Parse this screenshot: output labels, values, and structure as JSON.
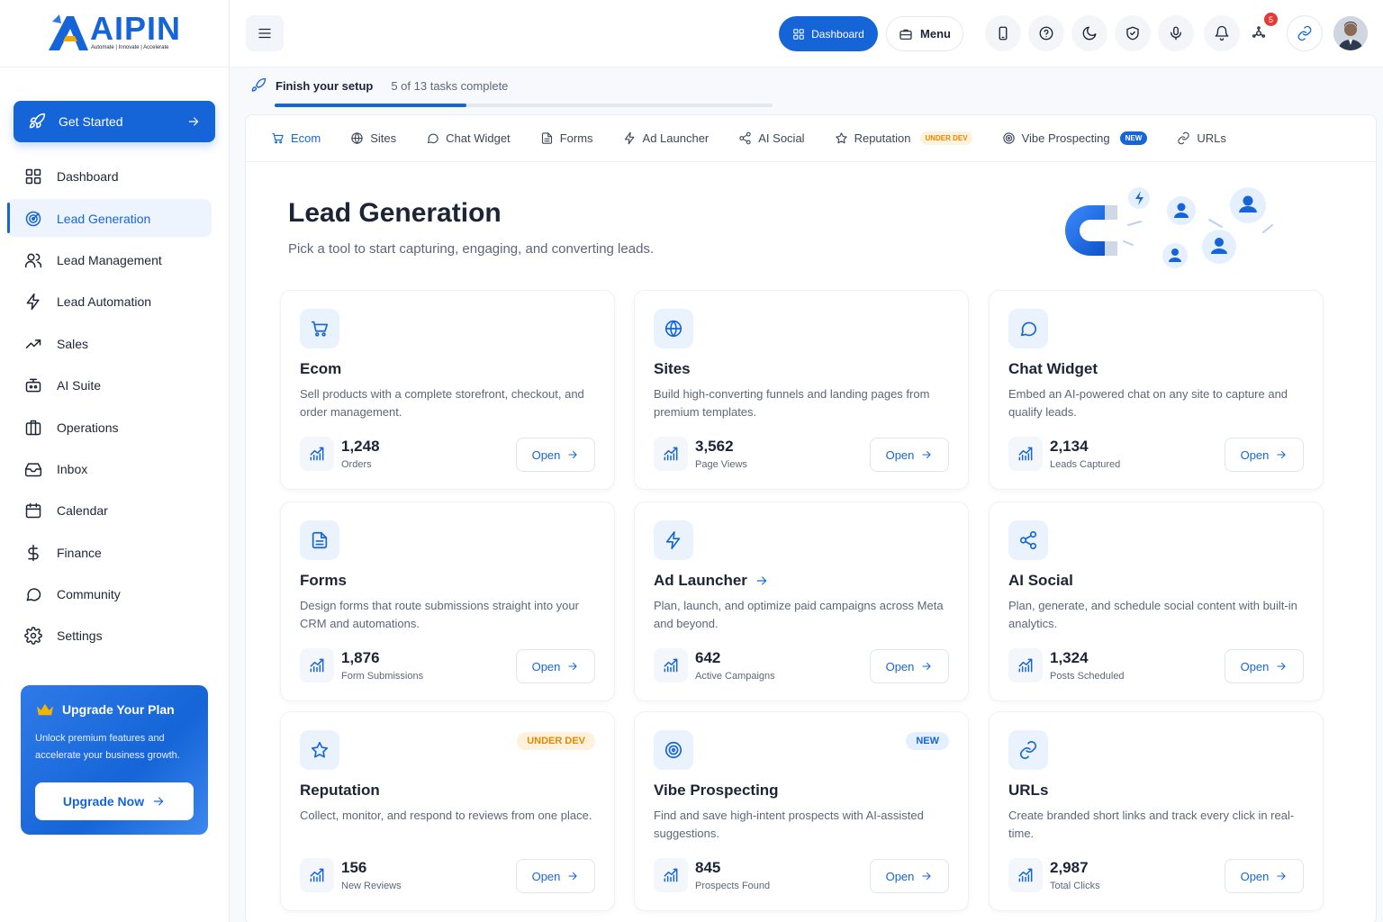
{
  "brand": {
    "name": "AIPIN",
    "tagline": "Automate | Innovate | Accelerate",
    "accent": "#1565d8"
  },
  "sidebar": {
    "get_started": "Get Started",
    "items": [
      {
        "label": "Dashboard",
        "icon": "grid-icon"
      },
      {
        "label": "Lead Generation",
        "icon": "radar-icon",
        "active": true
      },
      {
        "label": "Lead Management",
        "icon": "users-icon"
      },
      {
        "label": "Lead Automation",
        "icon": "bolt-icon"
      },
      {
        "label": "Sales",
        "icon": "trend-icon"
      },
      {
        "label": "AI Suite",
        "icon": "robot-icon"
      },
      {
        "label": "Operations",
        "icon": "building-icon"
      },
      {
        "label": "Inbox",
        "icon": "inbox-icon"
      },
      {
        "label": "Calendar",
        "icon": "calendar-icon"
      },
      {
        "label": "Finance",
        "icon": "dollar-icon"
      },
      {
        "label": "Community",
        "icon": "chat-icon"
      },
      {
        "label": "Settings",
        "icon": "gear-icon"
      }
    ],
    "upgrade": {
      "title": "Upgrade Your Plan",
      "description": "Unlock premium features and accelerate your business growth.",
      "button": "Upgrade Now"
    }
  },
  "header": {
    "dashboard_button": "Dashboard",
    "menu_button": "Menu",
    "notification_count": "5"
  },
  "setup": {
    "title": "Finish your setup",
    "status": "5 of 13 tasks complete",
    "progress": 0.385
  },
  "tabs": [
    {
      "label": "Ecom",
      "active": true
    },
    {
      "label": "Sites"
    },
    {
      "label": "Chat Widget"
    },
    {
      "label": "Forms"
    },
    {
      "label": "Ad Launcher"
    },
    {
      "label": "AI Social"
    },
    {
      "label": "Reputation",
      "tag": "UNDER DEV"
    },
    {
      "label": "Vibe Prospecting",
      "tag": "NEW"
    },
    {
      "label": "URLs"
    }
  ],
  "page": {
    "title": "Lead Generation",
    "subtitle": "Pick a tool to start capturing, engaging, and converting leads."
  },
  "cards": [
    {
      "title": "Ecom",
      "description": "Sell products with a complete storefront, checkout, and order management.",
      "stat": "1,248",
      "stat_label": "Orders",
      "button": "Open"
    },
    {
      "title": "Sites",
      "description": "Build high-converting funnels and landing pages from premium templates.",
      "stat": "3,562",
      "stat_label": "Page Views",
      "button": "Open"
    },
    {
      "title": "Chat Widget",
      "description": "Embed an AI-powered chat on any site to capture and qualify leads.",
      "stat": "2,134",
      "stat_label": "Leads Captured",
      "button": "Open"
    },
    {
      "title": "Forms",
      "description": "Design forms that route submissions straight into your CRM and automations.",
      "stat": "1,876",
      "stat_label": "Form Submissions",
      "button": "Open"
    },
    {
      "title": "Ad Launcher",
      "description": "Plan, launch, and optimize paid campaigns across Meta and beyond.",
      "stat": "642",
      "stat_label": "Active Campaigns",
      "button": "Open"
    },
    {
      "title": "AI Social",
      "description": "Plan, generate, and schedule social content with built-in analytics.",
      "stat": "1,324",
      "stat_label": "Posts Scheduled",
      "button": "Open"
    },
    {
      "title": "Reputation",
      "tag": "UNDER DEV",
      "description": "Collect, monitor, and respond to reviews from one place.",
      "stat": "156",
      "stat_label": "New Reviews",
      "button": "Open"
    },
    {
      "title": "Vibe Prospecting",
      "tag": "NEW",
      "description": "Find and save high-intent prospects with AI-assisted suggestions.",
      "stat": "845",
      "stat_label": "Prospects Found",
      "button": "Open"
    },
    {
      "title": "URLs",
      "description": "Create branded short links and track every click in real-time.",
      "stat": "2,987",
      "stat_label": "Total Clicks",
      "button": "Open"
    }
  ]
}
